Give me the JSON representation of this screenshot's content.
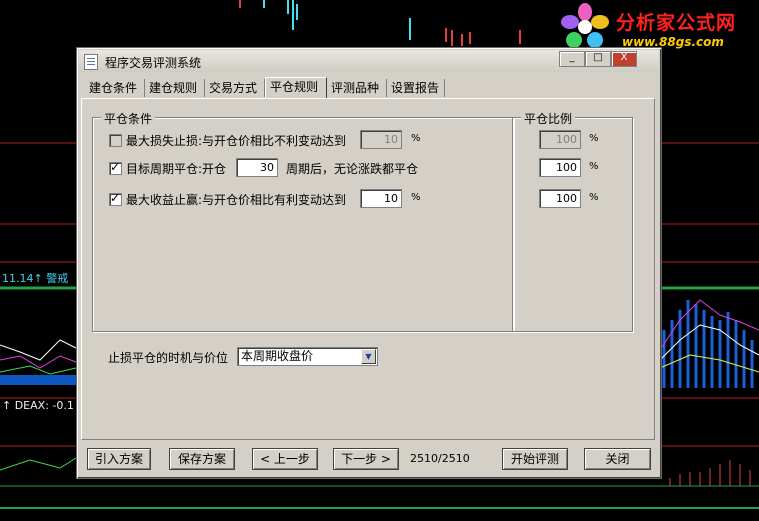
{
  "background": {
    "watermark_title": "分析家公式网",
    "watermark_url": "www.88gs.com",
    "indicator_value": "11.14↑ 警戒",
    "indicator_deax": "↑ DEAX: -0.1"
  },
  "window": {
    "title": "程序交易评测系统",
    "minimize_label": "_",
    "maximize_label": "□",
    "close_label": "X"
  },
  "tabs": [
    {
      "label": "建仓条件"
    },
    {
      "label": "建仓规则"
    },
    {
      "label": "交易方式"
    },
    {
      "label": "平仓规则"
    },
    {
      "label": "评测品种"
    },
    {
      "label": "设置报告"
    }
  ],
  "exit_conditions": {
    "group_title": "平仓条件",
    "stop_loss": {
      "label": "最大损失止损:与开仓价相比不利变动达到",
      "value": "10",
      "unit": "%",
      "checked": false
    },
    "target_period": {
      "label_before": "目标周期平仓:开仓",
      "value": "30",
      "label_after": "周期后，无论涨跌都平仓",
      "checked": true
    },
    "take_profit": {
      "label": "最大收益止赢:与开仓价相比有利变动达到",
      "value": "10",
      "unit": "%",
      "checked": true
    }
  },
  "exit_ratio": {
    "group_title": "平仓比例",
    "rows": [
      {
        "value": "100",
        "unit": "%"
      },
      {
        "value": "100",
        "unit": "%"
      },
      {
        "value": "100",
        "unit": "%"
      }
    ]
  },
  "stop_timing": {
    "label": "止损平仓的时机与价位",
    "selected": "本周期收盘价"
  },
  "footer": {
    "import_label": "引入方案",
    "save_label": "保存方案",
    "prev_label": "< 上一步",
    "next_label": "下一步 >",
    "step_indicator": "2510/2510",
    "start_label": "开始评测",
    "close_label": "关闭"
  }
}
